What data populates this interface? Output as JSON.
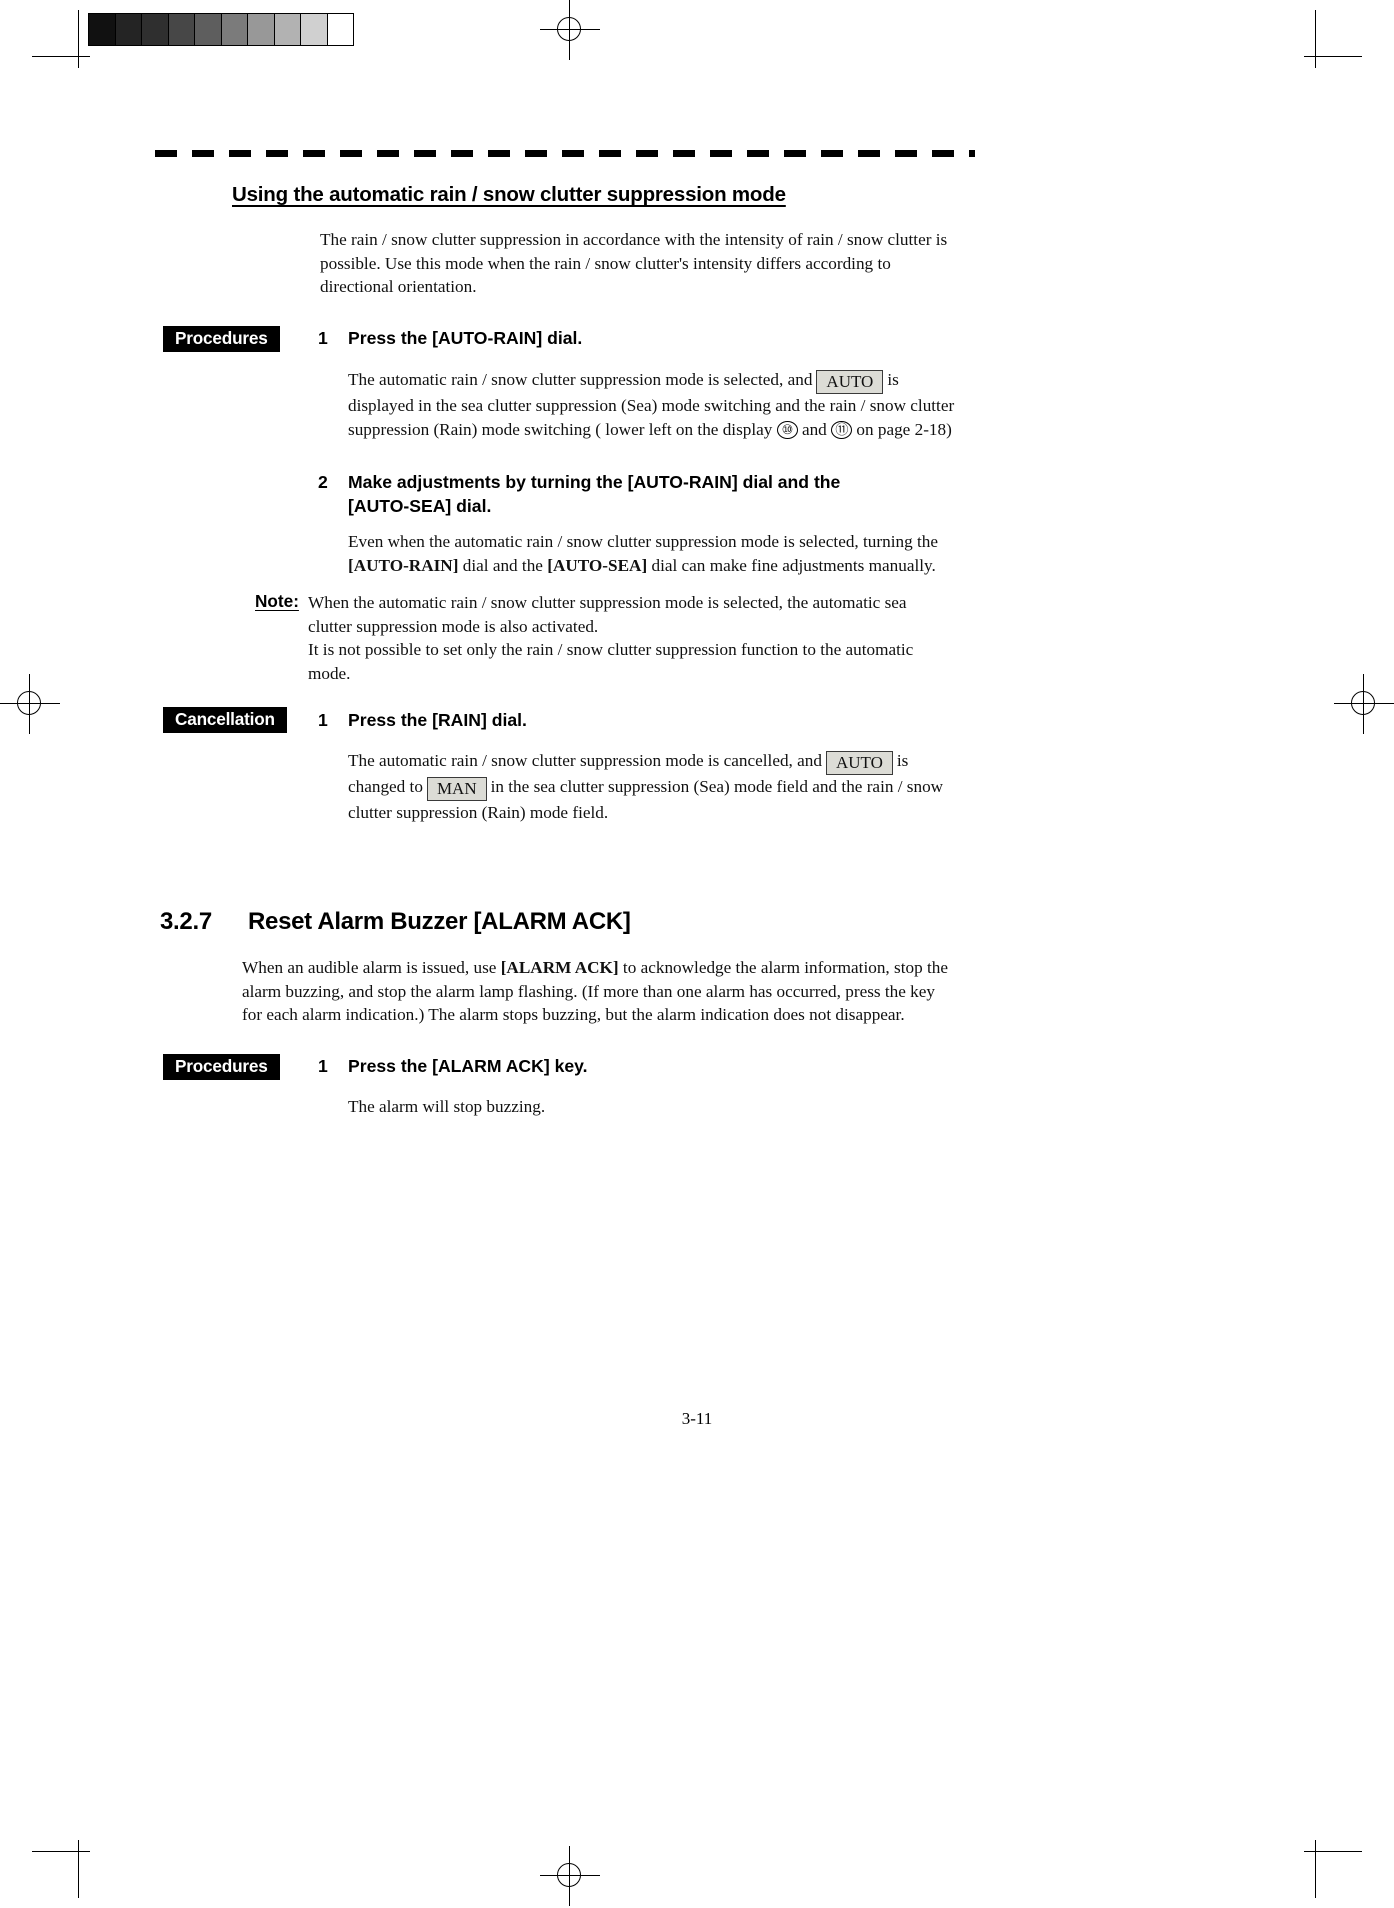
{
  "document": {
    "page_number": "3-11",
    "grayscale_patches": [
      "#111111",
      "#242424",
      "#2f2f2f",
      "#474747",
      "#5e5e5e",
      "#7b7b7b",
      "#989898",
      "#b2b2b2",
      "#d0d0d0",
      "#ffffff"
    ]
  },
  "section_rain": {
    "title": "Using the automatic rain / snow clutter suppression mode",
    "intro": "The rain / snow clutter suppression in accordance with the intensity of rain / snow clutter is possible.    Use this mode when the rain / snow clutter's intensity differs according to directional orientation.",
    "procedures_tag": "Procedures",
    "step1": {
      "number": "1",
      "heading": "Press the [AUTO-RAIN] dial.",
      "body_part1": "The automatic rain / snow clutter suppression mode is selected, and",
      "lcd_auto": "AUTO",
      "body_part2": "is displayed in the sea clutter suppression (Sea) mode switching and the rain / snow clutter suppression (Rain) mode switching ( lower left on the display",
      "circled_a": "⑩",
      "and_text": "and",
      "circled_b": "⑪",
      "body_part3": "on page 2-18)"
    },
    "step2": {
      "number": "2",
      "heading_line1": "Make adjustments by turning the [AUTO-RAIN] dial and the",
      "heading_line2": "[AUTO-SEA] dial.",
      "body_part1": "Even when the automatic rain / snow clutter suppression mode is selected, turning the",
      "bold_rain": "[AUTO-RAIN]",
      "body_part2": "dial and the",
      "bold_sea": "[AUTO-SEA]",
      "body_part3": "dial can make fine adjustments manually."
    },
    "note": {
      "label": "Note:",
      "line1": "When the automatic rain / snow clutter suppression mode is selected, the automatic sea clutter suppression mode is also activated.",
      "line2": "It is not possible to set only the rain / snow clutter suppression function to the automatic mode."
    },
    "cancellation_tag": "Cancellation",
    "cancel_step1": {
      "number": "1",
      "heading": "Press the [RAIN] dial.",
      "body_part1": "The automatic rain / snow clutter suppression mode is cancelled, and",
      "lcd_auto": "AUTO",
      "body_part2": "is changed to",
      "lcd_man": "MAN",
      "body_part3": "in the sea clutter suppression (Sea) mode field and the rain / snow clutter suppression (Rain) mode field."
    }
  },
  "section_alarm": {
    "number": "3.2.7",
    "title": "Reset Alarm Buzzer [ALARM ACK]",
    "body_part1": "When an audible alarm is issued, use",
    "bold_term": "[ALARM ACK]",
    "body_part2": "to acknowledge the alarm information, stop the alarm buzzing, and stop the alarm lamp flashing.    (If more than one alarm has occurred, press the key for each alarm indication.) The alarm stops buzzing, but the alarm indication does not disappear.",
    "procedures_tag": "Procedures",
    "step1": {
      "number": "1",
      "heading": "Press the [ALARM ACK] key.",
      "body": "The alarm will stop buzzing."
    }
  }
}
